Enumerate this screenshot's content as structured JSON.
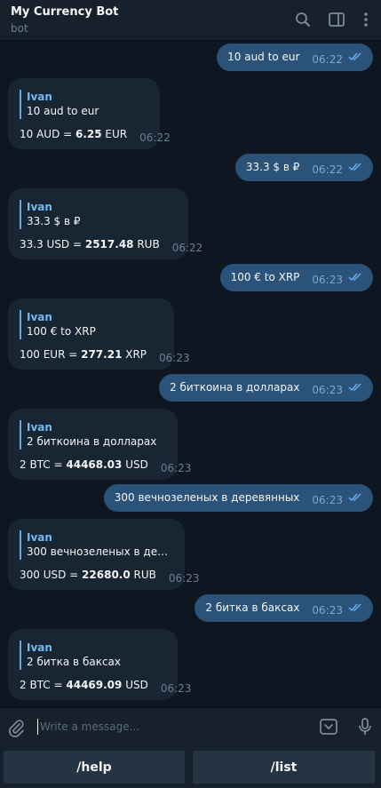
{
  "header": {
    "title": "My Currency Bot",
    "subtitle": "bot"
  },
  "messages": [
    {
      "type": "out",
      "text": "10 aud to eur",
      "time": "06:22"
    },
    {
      "type": "in",
      "quote_name": "Ivan",
      "quote_text": "10 aud to eur",
      "result_prefix": "10 AUD = ",
      "result_value": "6.25",
      "result_suffix": " EUR",
      "time": "06:22"
    },
    {
      "type": "out",
      "text": "33.3 $ в ₽",
      "time": "06:22"
    },
    {
      "type": "in",
      "quote_name": "Ivan",
      "quote_text": "33.3 $ в ₽",
      "result_prefix": "33.3 USD = ",
      "result_value": "2517.48",
      "result_suffix": " RUB",
      "time": "06:22"
    },
    {
      "type": "out",
      "text": "100 € to XRP",
      "time": "06:23"
    },
    {
      "type": "in",
      "quote_name": "Ivan",
      "quote_text": "100 € to XRP",
      "result_prefix": "100 EUR = ",
      "result_value": "277.21",
      "result_suffix": " XRP",
      "time": "06:23"
    },
    {
      "type": "out",
      "text": "2 биткоина в долларах",
      "time": "06:23"
    },
    {
      "type": "in",
      "quote_name": "Ivan",
      "quote_text": "2 биткоина в долларах",
      "result_prefix": "2 BTC = ",
      "result_value": "44468.03",
      "result_suffix": " USD",
      "time": "06:23"
    },
    {
      "type": "out",
      "text": "300 вечнозеленых в деревянных",
      "time": "06:23"
    },
    {
      "type": "in",
      "quote_name": "Ivan",
      "quote_text": "300 вечнозеленых в дере...",
      "result_prefix": "300 USD = ",
      "result_value": "22680.0",
      "result_suffix": " RUB",
      "time": "06:23"
    },
    {
      "type": "out",
      "text": "2 битка в баксах",
      "time": "06:23"
    },
    {
      "type": "in",
      "quote_name": "Ivan",
      "quote_text": "2 битка в баксах",
      "result_prefix": "2 BTC = ",
      "result_value": "44469.09",
      "result_suffix": " USD",
      "time": "06:23"
    }
  ],
  "composer": {
    "placeholder": "Write a message..."
  },
  "keyboard": {
    "buttons": [
      "/help",
      "/list"
    ]
  },
  "icons": {
    "header": [
      "search-icon",
      "sidebar-toggle-icon",
      "more-vertical-icon"
    ],
    "composer": [
      "attach-icon",
      "bot-commands-icon",
      "microphone-icon"
    ],
    "read_status": "double-check-icon"
  },
  "colors": {
    "background": "#0e1621",
    "panel": "#17212b",
    "outgoing_bubble": "#2b5278",
    "incoming_bubble": "#182533",
    "accent": "#71baf2"
  }
}
